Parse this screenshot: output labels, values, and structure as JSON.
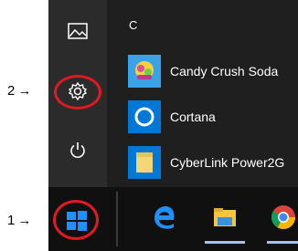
{
  "annotations": [
    {
      "label": "2",
      "arrow": "→"
    },
    {
      "label": "1",
      "arrow": "→"
    }
  ],
  "rail": {
    "items": [
      {
        "icon": "pictures-icon"
      },
      {
        "icon": "settings-icon"
      },
      {
        "icon": "power-icon"
      }
    ]
  },
  "section_letter": "C",
  "apps": [
    {
      "label": "Candy Crush Soda",
      "icon": "candy-crush-icon"
    },
    {
      "label": "Cortana",
      "icon": "cortana-icon"
    },
    {
      "label": "CyberLink Power2G",
      "icon": "cyberlink-icon"
    }
  ],
  "taskbar": {
    "start": {
      "icon": "windows-icon"
    },
    "pinned": [
      {
        "icon": "edge-icon"
      },
      {
        "icon": "file-explorer-icon"
      },
      {
        "icon": "chrome-icon"
      }
    ]
  },
  "colors": {
    "accent": "#0078d7",
    "highlight": "#e01a22"
  }
}
